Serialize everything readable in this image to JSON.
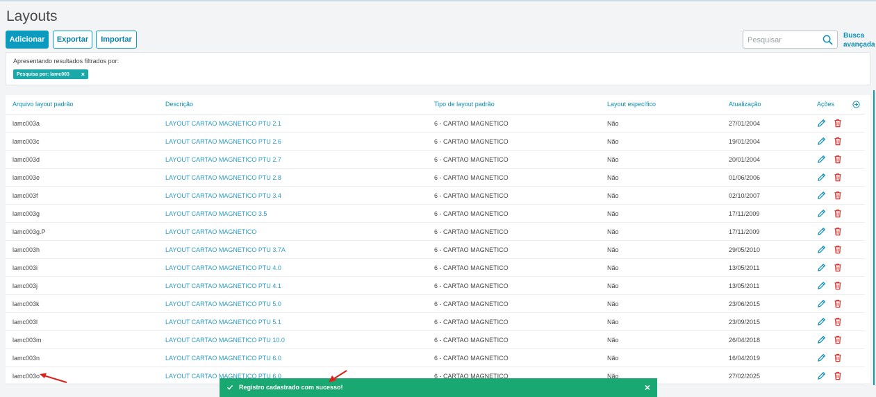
{
  "page": {
    "title": "Layouts"
  },
  "toolbar": {
    "add_label": "Adicionar",
    "export_label": "Exportar",
    "import_label": "Importar"
  },
  "search": {
    "placeholder": "Pesquisar",
    "advanced_line1": "Busca",
    "advanced_line2": "avançada"
  },
  "filter": {
    "label": "Apresentando resultados filtrados por:",
    "chip": "Pesquisa por: lamc003",
    "chip_close": "×"
  },
  "table": {
    "headers": [
      "Arquivo layout padrão",
      "Descrição",
      "Tipo de layout padrão",
      "Layout específico",
      "Atualização",
      "Ações"
    ],
    "rows": [
      [
        "lamc003a",
        "LAYOUT CARTAO MAGNETICO PTU 2.1",
        "6 - CARTAO MAGNETICO",
        "Não",
        "27/01/2004"
      ],
      [
        "lamc003c",
        "LAYOUT CARTAO MAGNETICO PTU 2.6",
        "6 - CARTAO MAGNETICO",
        "Não",
        "19/01/2004"
      ],
      [
        "lamc003d",
        "LAYOUT CARTAO MAGNETICO PTU 2.7",
        "6 - CARTAO MAGNETICO",
        "Não",
        "20/01/2004"
      ],
      [
        "lamc003e",
        "LAYOUT CARTAO MAGNETICO PTU 2.8",
        "6 - CARTAO MAGNETICO",
        "Não",
        "01/06/2006"
      ],
      [
        "lamc003f",
        "LAYOUT CARTAO MAGNETICO PTU 3.4",
        "6 - CARTAO MAGNETICO",
        "Não",
        "02/10/2007"
      ],
      [
        "lamc003g",
        "LAYOUT CARTAO MAGNETICO 3.5",
        "6 - CARTAO MAGNETICO",
        "Não",
        "17/11/2009"
      ],
      [
        "lamc003g.P",
        "LAYOUT CARTAO MAGNETICO",
        "6 - CARTAO MAGNETICO",
        "Não",
        "17/11/2009"
      ],
      [
        "lamc003h",
        "LAYOUT CARTAO MAGNETICO PTU 3.7A",
        "6 - CARTAO MAGNETICO",
        "Não",
        "29/05/2010"
      ],
      [
        "lamc003i",
        "LAYOUT CARTAO MAGNETICO PTU 4.0",
        "6 - CARTAO MAGNETICO",
        "Não",
        "13/05/2011"
      ],
      [
        "lamc003j",
        "LAYOUT CARTAO MAGNETICO PTU 4.1",
        "6 - CARTAO MAGNETICO",
        "Não",
        "13/05/2011"
      ],
      [
        "lamc003k",
        "LAYOUT CARTAO MAGNETICO PTU 5.0",
        "6 - CARTAO MAGNETICO",
        "Não",
        "23/06/2015"
      ],
      [
        "lamc003l",
        "LAYOUT CARTAO MAGNETICO PTU 5.1",
        "6 - CARTAO MAGNETICO",
        "Não",
        "23/09/2015"
      ],
      [
        "lamc003m",
        "LAYOUT CARTAO MAGNETICO PTU 10.0",
        "6 - CARTAO MAGNETICO",
        "Não",
        "26/04/2018"
      ],
      [
        "lamc003n",
        "LAYOUT CARTAO MAGNETICO PTU 6.0",
        "6 - CARTAO MAGNETICO",
        "Não",
        "16/04/2019"
      ],
      [
        "lamc003o",
        "LAYOUT CARTAO MAGNETICO PTU 6.0",
        "6 - CARTAO MAGNETICO",
        "Não",
        "27/02/2025"
      ]
    ]
  },
  "toast": {
    "message": "Registro cadastrado com sucesso!",
    "close": "×"
  },
  "icons": {
    "search": "search-icon",
    "edit": "pencil-icon",
    "delete": "trash-icon",
    "add_column": "plus-circle-icon",
    "toast_check": "check-icon",
    "annotation": "arrow-icon"
  },
  "colors": {
    "primary": "#0c9abe",
    "link": "#2a9bc4",
    "chip": "#1aa8a8",
    "toast": "#1aa872",
    "delete": "#d0302b",
    "annotation": "#e0201b"
  }
}
